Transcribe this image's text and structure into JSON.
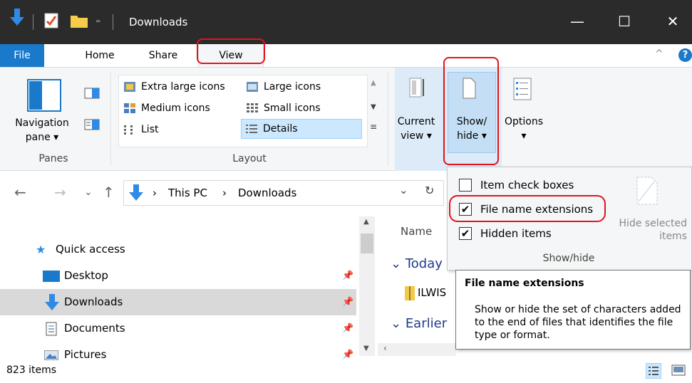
{
  "window": {
    "title": "Downloads",
    "minimize_glyph": "—",
    "maximize_glyph": "☐",
    "close_glyph": "✕",
    "help_glyph": "?",
    "collapse_glyph": "^"
  },
  "tabs": {
    "file": "File",
    "home": "Home",
    "share": "Share",
    "view": "View"
  },
  "ribbon": {
    "panes": {
      "navigation_pane_line1": "Navigation",
      "navigation_pane_line2": "pane ▾",
      "group_label": "Panes"
    },
    "layout": {
      "items": [
        "Extra large icons",
        "Large icons",
        "Medium icons",
        "Small icons",
        "List",
        "Details"
      ],
      "selected": "Details",
      "group_label": "Layout"
    },
    "current_view": {
      "line1": "Current",
      "line2": "view ▾"
    },
    "show_hide": {
      "line1": "Show/",
      "line2": "hide ▾"
    },
    "options": {
      "line1": "Options",
      "line2": "▾"
    }
  },
  "dropdown": {
    "checkboxes": [
      {
        "label": "Item check boxes",
        "checked": false
      },
      {
        "label": "File name extensions",
        "checked": true
      },
      {
        "label": "Hidden items",
        "checked": true
      }
    ],
    "hide_selected_line1": "Hide selected",
    "hide_selected_line2": "items",
    "group_label": "Show/hide"
  },
  "tooltip": {
    "title": "File name extensions",
    "body": "Show or hide the set of characters added to the end of files that identifies the file type or format."
  },
  "address": {
    "crumbs": [
      "This PC",
      "Downloads"
    ],
    "separator": "›",
    "dropdown_glyph": "⌄",
    "refresh_glyph": "↻"
  },
  "nav": {
    "back_glyph": "←",
    "forward_glyph": "→",
    "recent_glyph": "⌄",
    "up_glyph": "↑",
    "quick_access": "Quick access",
    "items": [
      "Desktop",
      "Downloads",
      "Documents",
      "Pictures"
    ],
    "pin_glyph": "📌"
  },
  "file_list": {
    "column_name": "Name",
    "group_today": "Today",
    "file_name": "ILWIS",
    "group_earlier": "Earlier"
  },
  "status": {
    "item_count": "823 items"
  },
  "colors": {
    "accent": "#1979ca",
    "titlebar": "#2b2b2b",
    "highlight_red": "#e0141e",
    "selected_bg": "#cce8ff",
    "nav_selected": "#d9d9d9"
  }
}
